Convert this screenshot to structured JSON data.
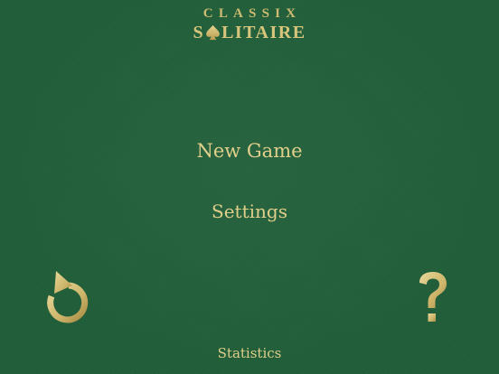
{
  "logo": {
    "top": "CLASSIX",
    "bottom_left": "S",
    "bottom_right": "LITAIRE",
    "spade_icon": "spade-icon"
  },
  "menu": {
    "new_game": "New Game",
    "settings": "Settings",
    "statistics": "Statistics"
  },
  "buttons": {
    "undo_icon": "undo-arrow-icon",
    "help_icon": "question-mark-icon"
  },
  "colors": {
    "felt": "#1f5e38",
    "gold": "#d8c57c"
  }
}
